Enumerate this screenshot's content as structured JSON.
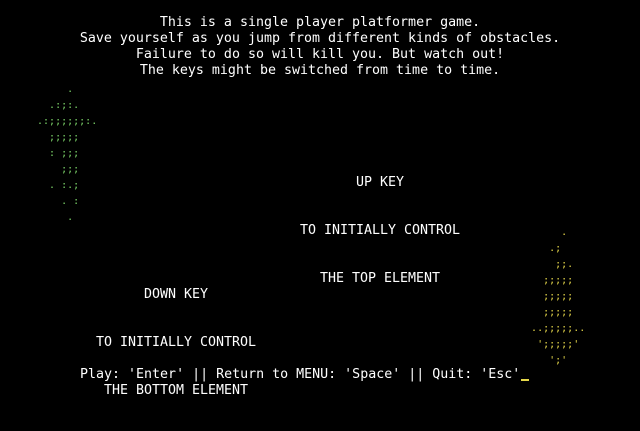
{
  "intro": {
    "lines": [
      "This is a single player platformer game.",
      "Save yourself as you jump from different kinds of obstacles.",
      "Failure to do so will kill you. But watch out!",
      "The keys might be switched from time to time."
    ]
  },
  "up_hint": {
    "lines": [
      "UP KEY",
      "TO INITIALLY CONTROL",
      "THE TOP ELEMENT"
    ]
  },
  "down_hint": {
    "lines": [
      "DOWN KEY",
      "TO INITIALLY CONTROL",
      "THE BOTTOM ELEMENT"
    ]
  },
  "up_arrow_art": "      .\n   .:;:.\n .:;;;;;;:.\n   ;;;;;\n   : ;;;\n     ;;;\n   . :.;\n     . :\n      .",
  "down_arrow_art": "        .\n      .;\n       ;;.\n     ;;;;;\n     ;;;;;\n     ;;;;;\n   ..;;;;;..\n    ';;;;;'\n      ';'",
  "footer": {
    "text": "Play: 'Enter' || Return to MENU: 'Space' || Quit: 'Esc'"
  },
  "colors": {
    "background": "#000000",
    "text": "#ffffff",
    "up_arrow": "#7dd66a",
    "down_arrow": "#e6d84a",
    "cursor": "#e6d84a"
  }
}
